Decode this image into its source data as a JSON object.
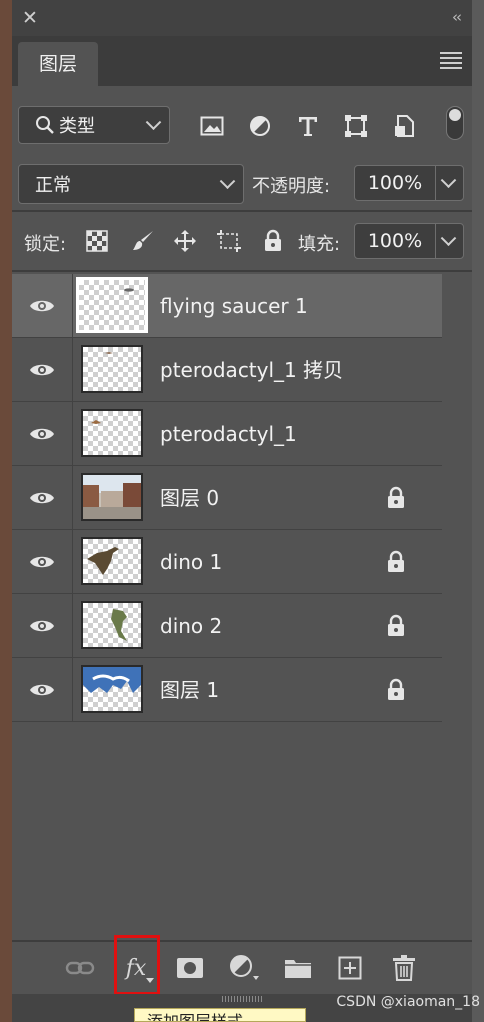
{
  "window": {
    "close_glyph": "✕",
    "collapse_glyph": "‹‹"
  },
  "tabs": [
    {
      "label": "图层"
    }
  ],
  "filter": {
    "label": "类型",
    "icons": [
      "image-filter-icon",
      "adjustment-filter-icon",
      "type-filter-icon",
      "shape-filter-icon",
      "smart-object-filter-icon"
    ]
  },
  "blend": {
    "mode": "正常",
    "opacity_label": "不透明度:",
    "opacity_value": "100%"
  },
  "lock": {
    "label": "锁定:",
    "icons": [
      "lock-transparent-pixels-icon",
      "lock-image-pixels-icon",
      "lock-position-icon",
      "lock-artboard-icon",
      "lock-all-icon"
    ],
    "fill_label": "填充:",
    "fill_value": "100%"
  },
  "layers": [
    {
      "name": "flying saucer 1",
      "selected": true,
      "locked": false,
      "thumb": "saucer"
    },
    {
      "name": "pterodactyl_1 拷贝",
      "selected": false,
      "locked": false,
      "thumb": "ptero-copy"
    },
    {
      "name": "pterodactyl_1",
      "selected": false,
      "locked": false,
      "thumb": "ptero"
    },
    {
      "name": "图层 0",
      "selected": false,
      "locked": true,
      "thumb": "town"
    },
    {
      "name": "dino 1",
      "selected": false,
      "locked": true,
      "thumb": "dino1"
    },
    {
      "name": "dino 2",
      "selected": false,
      "locked": true,
      "thumb": "dino2"
    },
    {
      "name": "图层 1",
      "selected": false,
      "locked": true,
      "thumb": "sky"
    }
  ],
  "bottom_bar": {
    "fx_label": "fx",
    "highlight_color": "#e01010",
    "icons": [
      "link-layers-icon",
      "fx-icon",
      "layer-mask-icon",
      "adjustment-layer-icon",
      "group-folder-icon",
      "new-layer-icon",
      "trash-icon"
    ]
  },
  "tooltip": {
    "text": "添加图层样式"
  },
  "watermark": {
    "text": "CSDN @xiaoman_18"
  },
  "colors": {
    "panel": "#535353",
    "selected_row": "#676767",
    "accent_red": "#e01010"
  }
}
